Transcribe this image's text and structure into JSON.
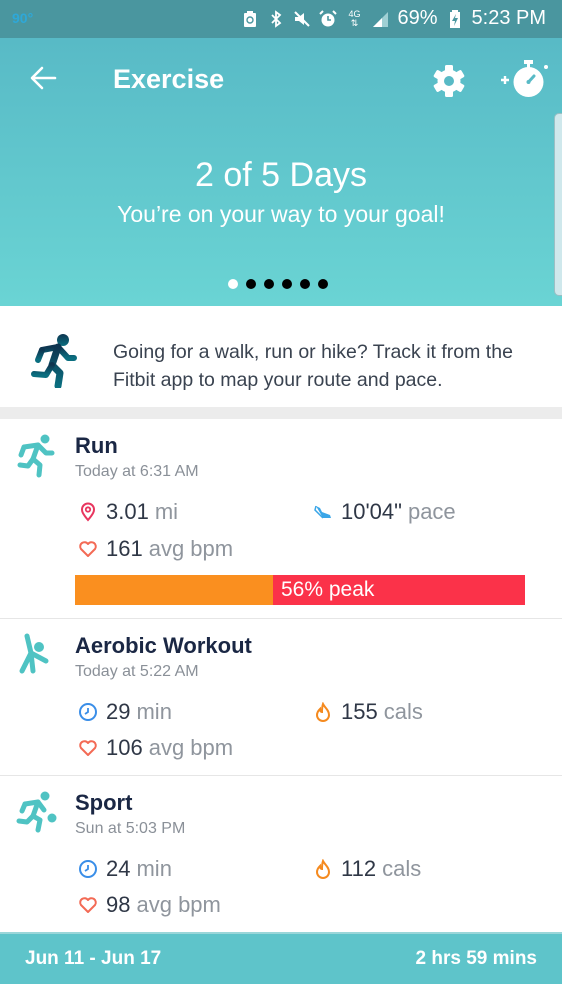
{
  "status_bar": {
    "temperature": "90°",
    "network": "4G",
    "battery": "69%",
    "time": "5:23 PM",
    "icons": [
      "battery-saver-icon",
      "bluetooth-icon",
      "mute-icon",
      "alarm-icon",
      "data-4g-icon",
      "signal-icon",
      "charging-battery-icon"
    ]
  },
  "header": {
    "title": "Exercise",
    "back_icon": "arrow-left-icon",
    "settings_icon": "gear-icon",
    "add_exercise_icon": "stopwatch-plus-icon"
  },
  "goal": {
    "headline": "2 of 5 Days",
    "message": "You’re on your way to your goal!",
    "pager": {
      "total_pages": 6,
      "active_page": 1
    }
  },
  "tip": {
    "icon": "runner-icon",
    "text": "Going for a walk, run or hike? Track it from the Fitbit app to map your route and pace."
  },
  "exercises": [
    {
      "icon": "run-icon",
      "name": "Run",
      "when": "Today at 6:31 AM",
      "stats": [
        {
          "icon": "location-pin-icon",
          "value": "3.01",
          "unit": "mi"
        },
        {
          "icon": "shoe-icon",
          "value": "10'04\"",
          "unit": "pace"
        },
        {
          "icon": "heart-icon",
          "value": "161",
          "unit": "avg bpm"
        }
      ],
      "heart_zones": {
        "label": "56% peak",
        "peak_fraction": 0.56
      }
    },
    {
      "icon": "aerobic-icon",
      "name": "Aerobic Workout",
      "when": "Today at 5:22 AM",
      "stats": [
        {
          "icon": "clock-icon",
          "value": "29",
          "unit": "min"
        },
        {
          "icon": "flame-icon",
          "value": "155",
          "unit": "cals"
        },
        {
          "icon": "heart-icon",
          "value": "106",
          "unit": "avg bpm"
        }
      ]
    },
    {
      "icon": "sport-icon",
      "name": "Sport",
      "when": "Sun at 5:03 PM",
      "stats": [
        {
          "icon": "clock-icon",
          "value": "24",
          "unit": "min"
        },
        {
          "icon": "flame-icon",
          "value": "112",
          "unit": "cals"
        },
        {
          "icon": "heart-icon",
          "value": "98",
          "unit": "avg bpm"
        }
      ]
    }
  ],
  "footer": {
    "date_range": "Jun 11 - Jun 17",
    "total_time": "2 hrs 59 mins"
  },
  "colors": {
    "status_bar": "#4a969f",
    "hero_top": "#58bac6",
    "hero_bottom": "#6ad4d4",
    "teal_icon": "#4fc3c3",
    "title_navy": "#1a2744",
    "hr_orange": "#fa8f1f",
    "hr_red": "#fb3249",
    "footer": "#5ec4ca"
  }
}
